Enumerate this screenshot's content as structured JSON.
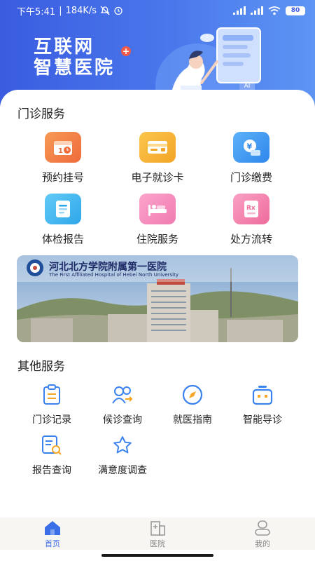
{
  "statusbar": {
    "time": "下午5:41",
    "speed": "184K/s",
    "battery": "80"
  },
  "banner": {
    "line1": "互联网",
    "line2": "智慧医院",
    "badge": "AI"
  },
  "outpatient": {
    "title": "门诊服务",
    "items": [
      {
        "label": "预约挂号",
        "icon": "calendar-icon",
        "color": "#f2844a"
      },
      {
        "label": "电子就诊卡",
        "icon": "card-icon",
        "color": "#f7b23b"
      },
      {
        "label": "门诊缴费",
        "icon": "payment-icon",
        "color": "#3d9af0"
      },
      {
        "label": "体检报告",
        "icon": "report-icon",
        "color": "#3fb7f0"
      },
      {
        "label": "住院服务",
        "icon": "bed-icon",
        "color": "#f589b8"
      },
      {
        "label": "处方流转",
        "icon": "prescription-icon",
        "color": "#f07aa7"
      }
    ]
  },
  "hospital_banner": {
    "name_cn": "河北北方学院附属第一医院",
    "name_en": "The First Affiliated Hospital of Hebei North University"
  },
  "other": {
    "title": "其他服务",
    "items": [
      {
        "label": "门诊记录",
        "icon": "clipboard-icon"
      },
      {
        "label": "候诊查询",
        "icon": "queue-icon"
      },
      {
        "label": "就医指南",
        "icon": "compass-icon"
      },
      {
        "label": "智能导诊",
        "icon": "robot-icon"
      },
      {
        "label": "报告查询",
        "icon": "report-search-icon"
      },
      {
        "label": "满意度调查",
        "icon": "star-icon"
      }
    ]
  },
  "tabbar": {
    "tabs": [
      {
        "label": "首页",
        "icon": "home-icon",
        "active": true
      },
      {
        "label": "医院",
        "icon": "hospital-icon",
        "active": false
      },
      {
        "label": "我的",
        "icon": "user-icon",
        "active": false
      }
    ]
  },
  "colors": {
    "accent": "#3b6fe8",
    "header_start": "#3a5ce0",
    "header_end": "#5e95f3"
  }
}
